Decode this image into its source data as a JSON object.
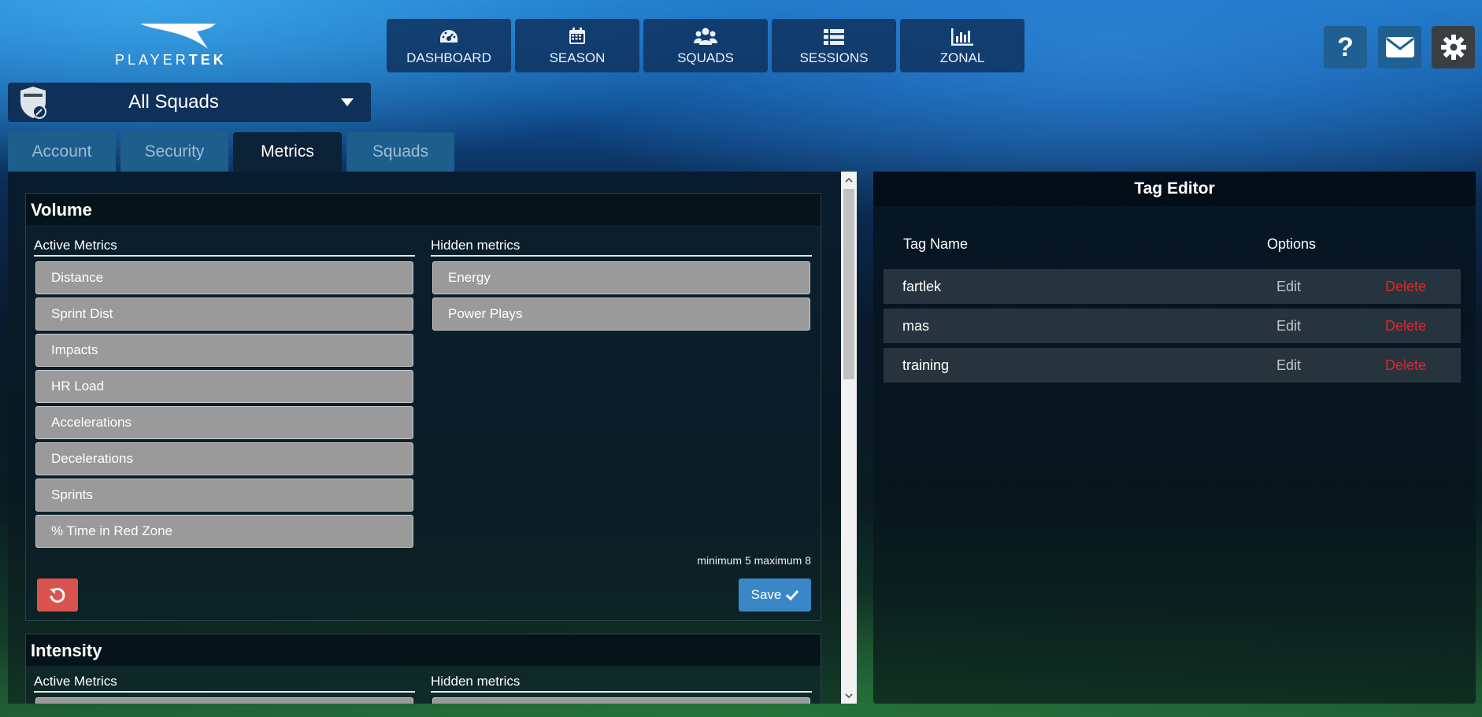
{
  "brand": {
    "logo_text_light": "PLAYER",
    "logo_text_bold": "TEK"
  },
  "nav": [
    {
      "label": "DASHBOARD",
      "icon": "dashboard-gauge-icon"
    },
    {
      "label": "SEASON",
      "icon": "calendar-icon"
    },
    {
      "label": "SQUADS",
      "icon": "users-group-icon"
    },
    {
      "label": "SESSIONS",
      "icon": "list-icon"
    },
    {
      "label": "ZONAL",
      "icon": "bar-chart-icon"
    }
  ],
  "header_actions": {
    "help": "?",
    "mail_icon": "envelope-icon",
    "settings_icon": "gear-icon"
  },
  "squad_selector": {
    "value": "All Squads",
    "badge_icon": "squad-shield-icon"
  },
  "tabs": [
    "Account",
    "Security",
    "Metrics",
    "Squads"
  ],
  "active_tab": "Metrics",
  "metrics": {
    "volume": {
      "title": "Volume",
      "active_header": "Active Metrics",
      "hidden_header": "Hidden metrics",
      "active": [
        "Distance",
        "Sprint Dist",
        "Impacts",
        "HR Load",
        "Accelerations",
        "Decelerations",
        "Sprints",
        "% Time in Red Zone"
      ],
      "hidden": [
        "Energy",
        "Power Plays"
      ],
      "limits_text": "minimum 5 maximum 8",
      "save_label": "Save"
    },
    "intensity": {
      "title": "Intensity",
      "active_header": "Active Metrics",
      "hidden_header": "Hidden metrics"
    }
  },
  "tag_editor": {
    "title": "Tag Editor",
    "col_name": "Tag Name",
    "col_options": "Options",
    "rows": [
      {
        "name": "fartlek",
        "edit": "Edit",
        "delete": "Delete"
      },
      {
        "name": "mas",
        "edit": "Edit",
        "delete": "Delete"
      },
      {
        "name": "training",
        "edit": "Edit",
        "delete": "Delete"
      }
    ]
  },
  "colors": {
    "delete": "#e3262a",
    "save": "#3a86c7",
    "reset": "#d9534f",
    "metric_chip": "#9a9a9a"
  }
}
